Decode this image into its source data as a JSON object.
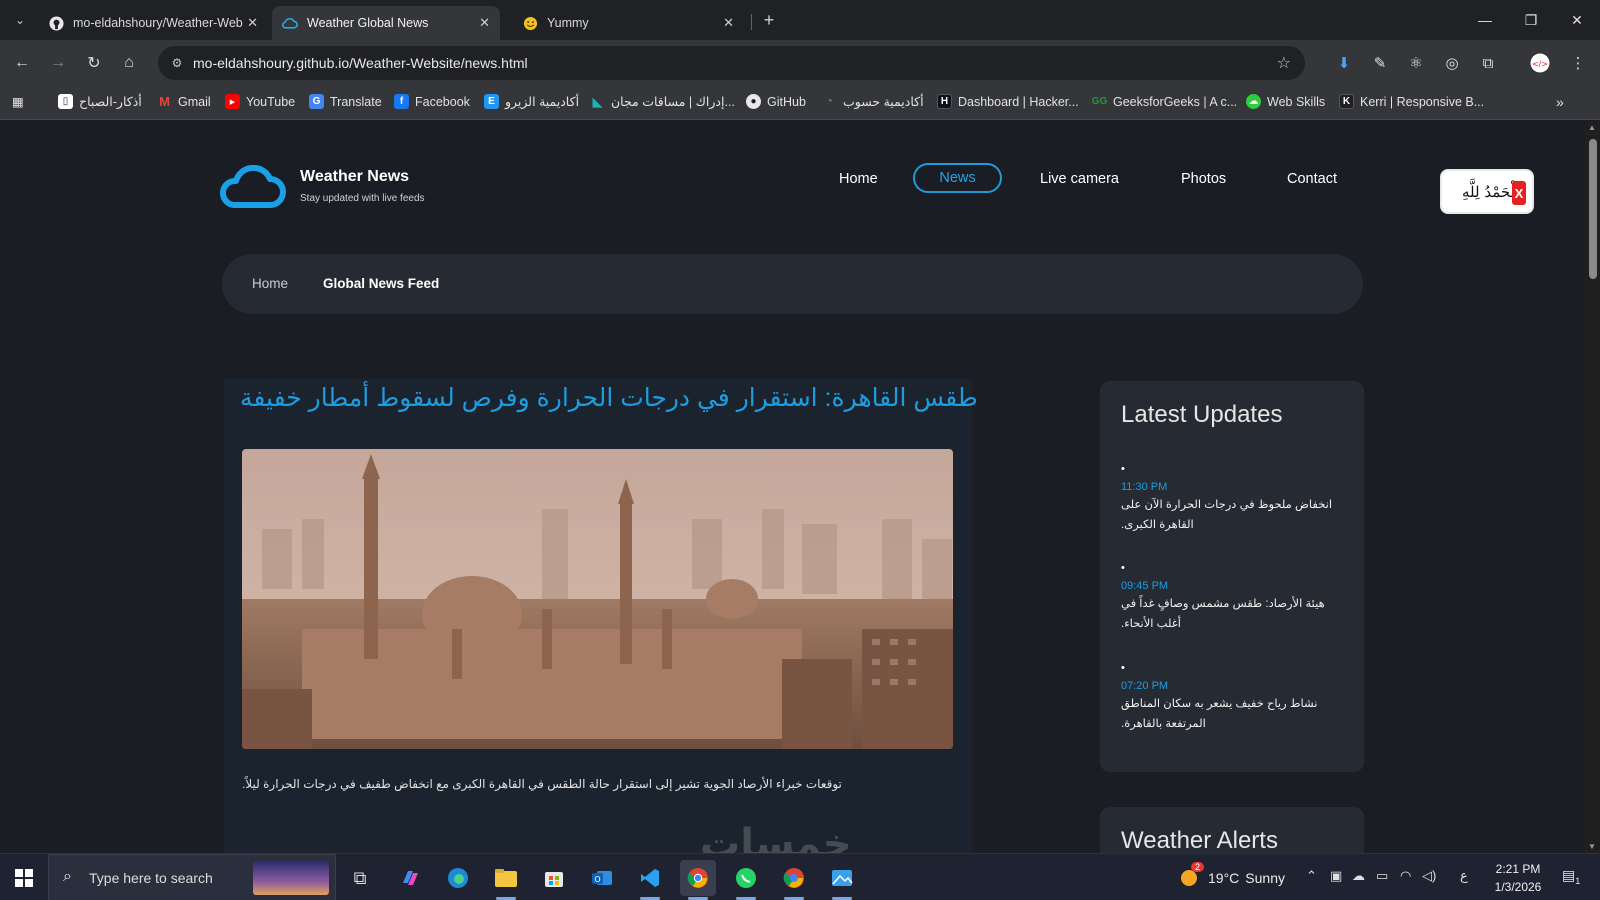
{
  "browser": {
    "tabs": [
      {
        "label": "mo-eldahshoury/Weather-Web",
        "icon": "github-icon",
        "active": false
      },
      {
        "label": "Weather Global News",
        "icon": "cloud-icon",
        "active": true
      },
      {
        "label": "Yummy",
        "icon": "yummy-icon",
        "active": false
      }
    ],
    "url": "mo-eldahshoury.github.io/Weather-Website/news.html",
    "bookmarks": [
      {
        "label": "أذكار-الصباح",
        "icon": "bookmark-icon"
      },
      {
        "label": "Gmail",
        "icon": "gmail-icon"
      },
      {
        "label": "YouTube",
        "icon": "youtube-icon"
      },
      {
        "label": "Translate",
        "icon": "translate-icon"
      },
      {
        "label": "Facebook",
        "icon": "facebook-icon"
      },
      {
        "label": "أكاديمية الزيرو",
        "icon": "elzero-icon"
      },
      {
        "label": "إدراك | مساقات مجان...",
        "icon": "edraak-icon"
      },
      {
        "label": "GitHub",
        "icon": "github-icon"
      },
      {
        "label": "أكاديمية حسوب",
        "icon": "hsoub-icon"
      },
      {
        "label": "Dashboard | Hacker...",
        "icon": "hackerrank-icon"
      },
      {
        "label": "GeeksforGeeks | A c...",
        "icon": "gfg-icon"
      },
      {
        "label": "Web Skills",
        "icon": "webskills-icon"
      },
      {
        "label": "Kerri | Responsive B...",
        "icon": "kerri-icon"
      }
    ]
  },
  "site": {
    "logo_title": "Weather News",
    "logo_subtitle": "Stay updated with live feeds",
    "nav": [
      {
        "label": "Home",
        "active": false
      },
      {
        "label": "News",
        "active": true
      },
      {
        "label": "Live camera",
        "active": false
      },
      {
        "label": "Photos",
        "active": false
      },
      {
        "label": "Contact",
        "active": false
      }
    ],
    "dhikr_text": "الْحَمْدُ لِلَّهِ",
    "dhikr_close": "X",
    "breadcrumb": {
      "home": "Home",
      "current": "Global News Feed"
    },
    "accent_color": "#1d9de0"
  },
  "article": {
    "title": "طقس القاهرة: استقرار في درجات الحرارة وفرص لسقوط أمطار خفيفة",
    "body": "توقعات خبراء الأرصاد الجوية تشير إلى استقرار حالة الطقس في القاهرة الكبرى مع انخفاض طفيف في درجات الحرارة ليلاً."
  },
  "sidebar": {
    "updates_title": "Latest Updates",
    "updates": [
      {
        "bullet": "•",
        "time": "11:30 PM",
        "text": "انخفاض ملحوظ في درجات الحرارة الآن على القاهرة الكبرى."
      },
      {
        "bullet": "•",
        "time": "09:45 PM",
        "text": "هيئة الأرصاد: طقس مشمس وصافٍ غداً في أغلب الأنحاء."
      },
      {
        "bullet": "•",
        "time": "07:20 PM",
        "text": "نشاط رياح خفيف يشعر به سكان المناطق المرتفعة بالقاهرة."
      }
    ],
    "alerts_title": "Weather Alerts"
  },
  "watermark": "خمسات",
  "taskbar": {
    "search_placeholder": "Type here to search",
    "weather_temp": "19°C",
    "weather_desc": "Sunny",
    "weather_badge": "2",
    "lang": "ع",
    "time": "2:21 PM",
    "date": "1/3/2026",
    "notif_count": "1"
  }
}
